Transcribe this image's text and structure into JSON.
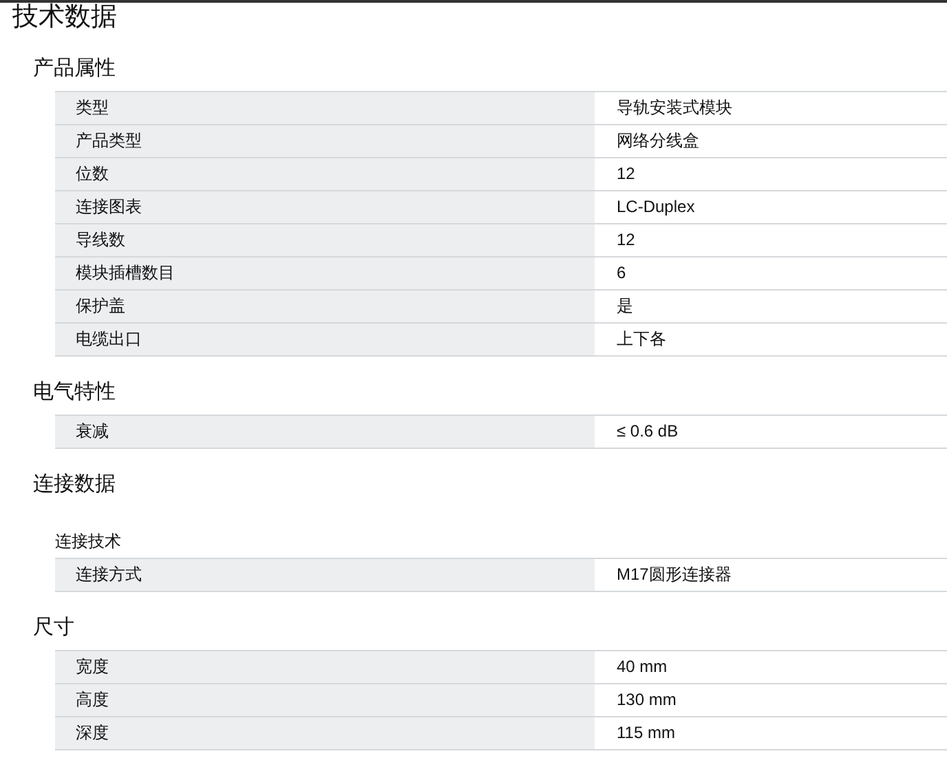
{
  "title": "技术数据",
  "sections": [
    {
      "heading": "产品属性",
      "rows": [
        {
          "label": "类型",
          "value": "导轨安装式模块"
        },
        {
          "label": "产品类型",
          "value": "网络分线盒"
        },
        {
          "label": "位数",
          "value": "12"
        },
        {
          "label": "连接图表",
          "value": "LC-Duplex"
        },
        {
          "label": "导线数",
          "value": "12"
        },
        {
          "label": "模块插槽数目",
          "value": "6"
        },
        {
          "label": "保护盖",
          "value": "是"
        },
        {
          "label": "电缆出口",
          "value": "上下各"
        }
      ]
    },
    {
      "heading": "电气特性",
      "rows": [
        {
          "label": "衰减",
          "value": "≤ 0.6 dB"
        }
      ]
    },
    {
      "heading": "连接数据",
      "subheading": "连接技术",
      "rows": [
        {
          "label": "连接方式",
          "value": "M17圆形连接器"
        }
      ]
    },
    {
      "heading": "尺寸",
      "rows": [
        {
          "label": "宽度",
          "value": "40 mm"
        },
        {
          "label": "高度",
          "value": "130 mm"
        },
        {
          "label": "深度",
          "value": "115 mm"
        }
      ]
    }
  ]
}
